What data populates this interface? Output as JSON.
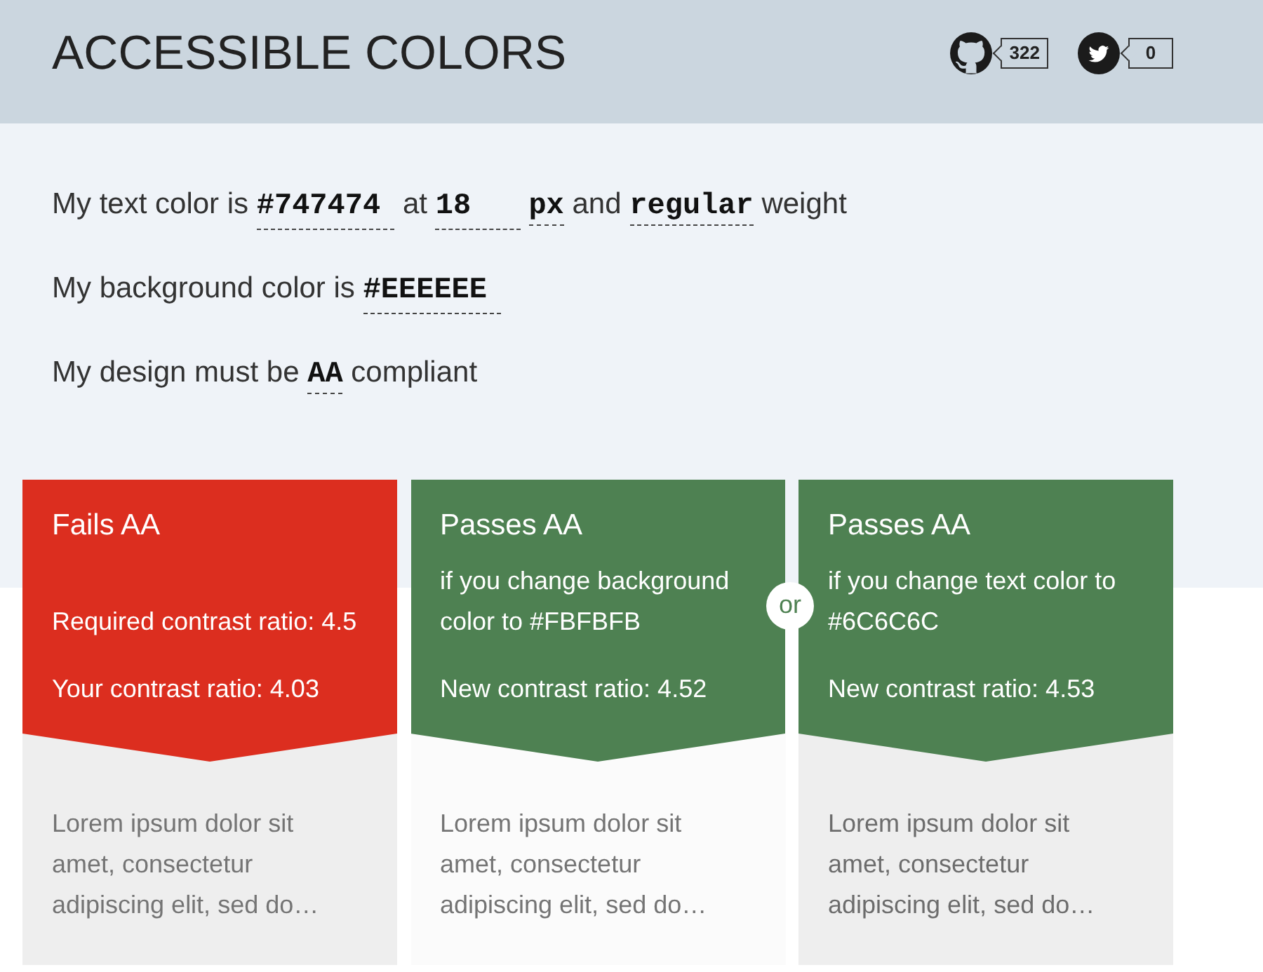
{
  "header": {
    "title": "ACCESSIBLE COLORS",
    "social": [
      {
        "kind": "github",
        "count": "322"
      },
      {
        "kind": "twitter",
        "count": "0"
      }
    ]
  },
  "settings": [
    [
      {
        "kind": "text",
        "text": "My text color is"
      },
      {
        "kind": "input",
        "text": "#747474"
      },
      {
        "kind": "text",
        "text": "at"
      },
      {
        "kind": "input",
        "text": "18"
      },
      {
        "kind": "select",
        "text": "px"
      },
      {
        "kind": "text",
        "text": "and"
      },
      {
        "kind": "select",
        "text": "regular"
      },
      {
        "kind": "text",
        "text": "weight"
      }
    ],
    [
      {
        "kind": "text",
        "text": "My background color is"
      },
      {
        "kind": "input",
        "text": "#EEEEEE"
      }
    ],
    [
      {
        "kind": "text",
        "text": "My design must be"
      },
      {
        "kind": "select",
        "text": "AA"
      },
      {
        "kind": "text",
        "text": "compliant"
      }
    ]
  ],
  "separator": "or",
  "results": [
    {
      "kind": "fail",
      "title": "Fails AA",
      "ratios": [
        "Required contrast ratio: 4.5",
        "Your contrast ratio: 4.03"
      ],
      "sample": {
        "color": "#eeeeee",
        "paragraph": {
          "text": "Lorem ipsum dolor sit amet, consectetur adipiscing elit, sed do…",
          "color": "#747474"
        }
      }
    },
    {
      "kind": "pass",
      "title": "Passes AA",
      "note": "if you change background color to #FBFBFB",
      "ratios": [
        "New contrast ratio: 4.52"
      ],
      "sample": {
        "color": "#fbfbfb",
        "paragraph": {
          "text": "Lorem ipsum dolor sit amet, consectetur adipiscing elit, sed do…",
          "color": "#747474"
        }
      }
    },
    {
      "kind": "pass",
      "title": "Passes AA",
      "note": "if you change text color to #6C6C6C",
      "ratios": [
        "New contrast ratio: 4.53"
      ],
      "sample": {
        "color": "#eeeeee",
        "paragraph": {
          "text": "Lorem ipsum dolor sit amet, consectetur adipiscing elit, sed do…",
          "color": "#6c6c6c"
        }
      }
    }
  ]
}
